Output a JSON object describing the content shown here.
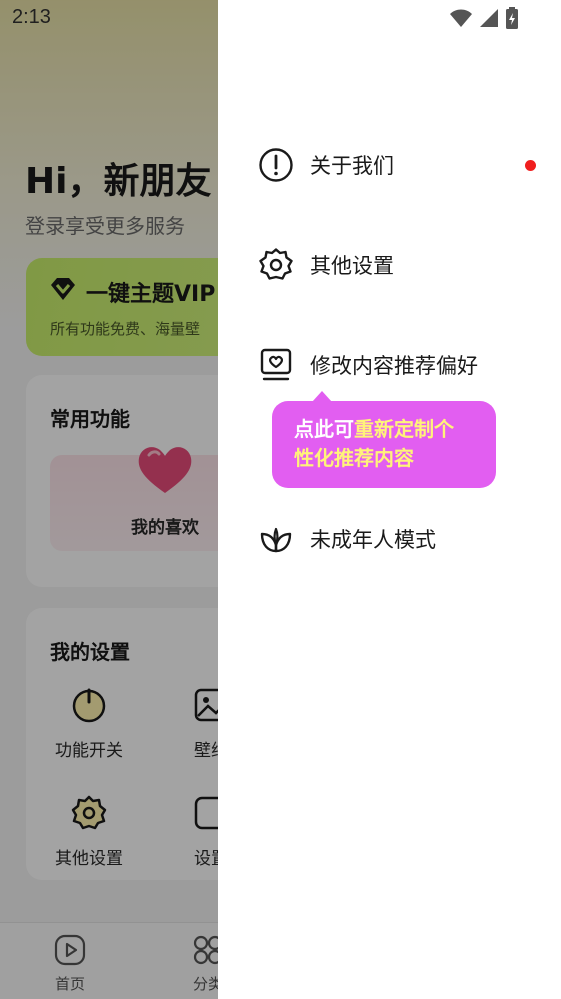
{
  "status_bar": {
    "time": "2:13"
  },
  "profile": {
    "greeting": "Hi，新朋友",
    "login_prompt": "登录享受更多服务",
    "vip": {
      "title": "一键主题VIP",
      "subtitle": "所有功能免费、海量壁"
    },
    "common_functions": {
      "title": "常用功能",
      "favorites_label": "我的喜欢"
    },
    "my_settings": {
      "title": "我的设置",
      "items": [
        {
          "label": "功能开关",
          "icon": "power-icon"
        },
        {
          "label": "壁纸",
          "icon": "wallpaper-icon"
        },
        {
          "label": "其他设置",
          "icon": "gear-icon"
        },
        {
          "label": "设置",
          "icon": "settings-card-icon"
        }
      ]
    }
  },
  "bottom_nav": [
    {
      "label": "首页",
      "icon": "play-icon"
    },
    {
      "label": "分类",
      "icon": "category-icon"
    }
  ],
  "drawer": {
    "menu": [
      {
        "label": "关于我们",
        "icon": "info-icon",
        "badge": "red-dot"
      },
      {
        "label": "其他设置",
        "icon": "gear-icon"
      },
      {
        "label": "修改内容推荐偏好",
        "icon": "recommend-preference-icon"
      },
      {
        "label": "未成年人模式",
        "icon": "sprout-icon"
      }
    ],
    "tooltip": {
      "prefix": "点此可",
      "highlight": "重新定制个",
      "line2": "性化推荐内容"
    }
  },
  "colors": {
    "tooltip_bg": "#e25ef1",
    "tooltip_highlight": "#fff37a",
    "badge_red": "#f01e1e",
    "vip_green": "#c9f06c"
  }
}
